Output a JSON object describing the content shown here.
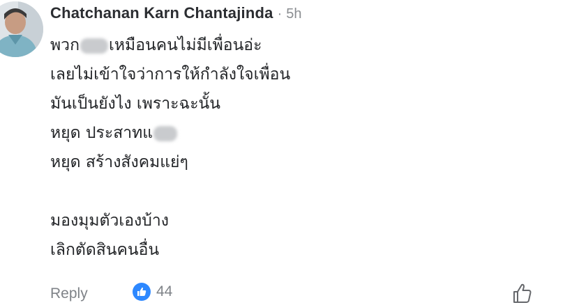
{
  "comment": {
    "author": "Chatchanan Karn Chantajinda",
    "separator": "·",
    "time": "5h",
    "lines": [
      {
        "before": "พวก",
        "after": "เหมือนคนไม่มีเพื่อนอ่ะ"
      },
      "เลยไม่เข้าใจว่าการให้กำลังใจเพื่อน",
      "มันเป็นยังไง เพราะฉะนั้น",
      {
        "before": "หยุด ประสาทแ",
        "after": ""
      },
      "หยุด สร้างสังคมแย่ๆ",
      "มองมุมตัวเองบ้าง",
      "เลิกตัดสินคนอื่น"
    ]
  },
  "actions": {
    "reply_label": "Reply",
    "like_count": "44",
    "reaction_icon": "like-reaction-icon",
    "like_icon": "thumbs-up-outline-icon"
  },
  "colors": {
    "reaction_blue": "#2d88ff",
    "meta_gray": "#8a8d91",
    "text": "#222427"
  }
}
